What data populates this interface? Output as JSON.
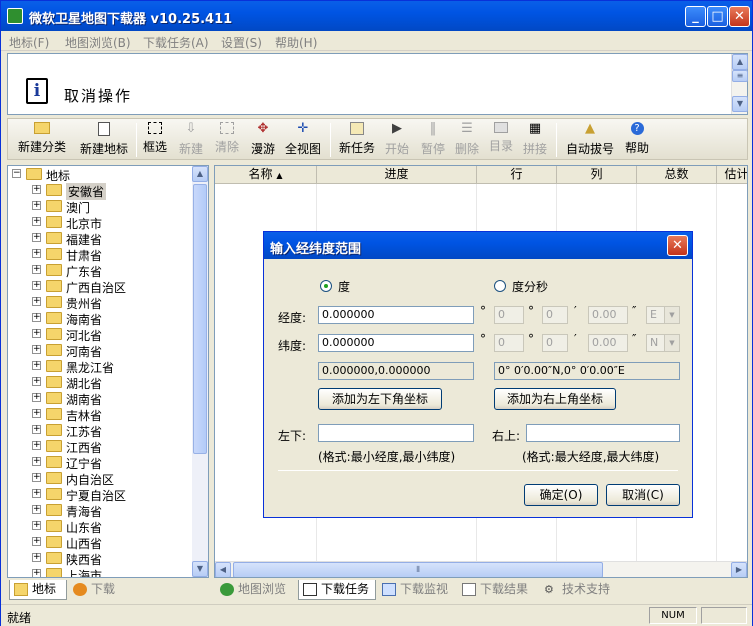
{
  "window": {
    "title": "微软卫星地图下载器 v10.25.411",
    "min": "_",
    "max": "□",
    "close": "✕"
  },
  "menu": [
    "地标(F)",
    "地图浏览(B)",
    "下载任务(A)",
    "设置(S)",
    "帮助(H)"
  ],
  "info": {
    "message": "取消操作",
    "icon_glyph": "i"
  },
  "toolbar": {
    "new_category": "新建分类",
    "new_placemark": "新建地标",
    "select": "框选",
    "create": "新建",
    "clear": "清除",
    "roam": "漫游",
    "full_view": "全视图",
    "new_task": "新任务",
    "start": "开始",
    "pause": "暂停",
    "delete": "删除",
    "directory": "目录",
    "stitch": "拼接",
    "auto_dial": "自动拔号",
    "help": "帮助"
  },
  "tree": {
    "root": "地标",
    "items": [
      "安徽省",
      "澳门",
      "北京市",
      "福建省",
      "甘肃省",
      "广东省",
      "广西自治区",
      "贵州省",
      "海南省",
      "河北省",
      "河南省",
      "黑龙江省",
      "湖北省",
      "湖南省",
      "吉林省",
      "江苏省",
      "江西省",
      "辽宁省",
      "内自治区",
      "宁夏自治区",
      "青海省",
      "山东省",
      "山西省",
      "陕西省",
      "上海市"
    ],
    "selected": "安徽省"
  },
  "left_tabs": {
    "placemark": "地标",
    "download": "下载"
  },
  "table": {
    "columns": [
      "名称",
      "进度",
      "行",
      "列",
      "总数",
      "估计"
    ],
    "sort_indicator": "▲"
  },
  "bottom_tabs": {
    "map_browse": "地图浏览",
    "download_task": "下载任务",
    "download_monitor": "下载监视",
    "download_result": "下载结果",
    "tech_support": "技术支持"
  },
  "status": {
    "text": "就绪",
    "num": "NUM"
  },
  "dialog": {
    "title": "输入经纬度范围",
    "close": "✕",
    "radio_degree": "度",
    "radio_dms": "度分秒",
    "longitude_label": "经度:",
    "latitude_label": "纬度:",
    "longitude_value": "0.000000",
    "latitude_value": "0.000000",
    "deg_sym": "°",
    "min_sym": "′",
    "sec_sym": "″",
    "lon_deg": "0",
    "lon_min": "0",
    "lon_sec": "0.00",
    "lon_dir": "E",
    "lat_deg": "0",
    "lat_min": "0",
    "lat_sec": "0.00",
    "lat_dir": "N",
    "decimal_readout": "0.000000,0.000000",
    "dms_readout": "0° 0′0.00″N,0° 0′0.00″E",
    "add_lower_left": "添加为左下角坐标",
    "add_upper_right": "添加为右上角坐标",
    "lower_left_label": "左下:",
    "upper_right_label": "右上:",
    "lower_left_value": "",
    "upper_right_value": "",
    "lower_left_hint": "(格式:最小经度,最小纬度)",
    "upper_right_hint": "(格式:最大经度,最大纬度)",
    "ok": "确定(O)",
    "cancel": "取消(C)"
  }
}
